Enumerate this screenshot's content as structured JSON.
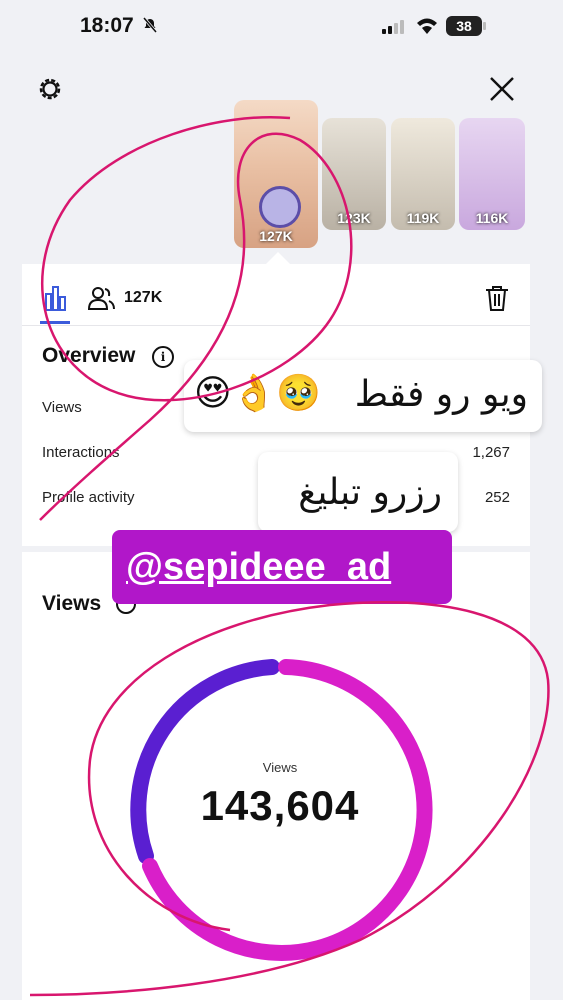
{
  "status_bar": {
    "time": "18:07",
    "battery": "38"
  },
  "stories": [
    {
      "label": "127K"
    },
    {
      "label": "123K"
    },
    {
      "label": "119K"
    },
    {
      "label": "116K"
    }
  ],
  "tabs": {
    "audience_count": "127K"
  },
  "overview": {
    "title": "Overview",
    "rows": [
      {
        "label": "Views",
        "value": ""
      },
      {
        "label": "Interactions",
        "value": "1,267"
      },
      {
        "label": "Profile activity",
        "value": "252"
      }
    ]
  },
  "views_section": {
    "title": "Views",
    "donut_label": "Views",
    "donut_value": "143,604"
  },
  "stickers": {
    "line1": "ویو رو فقط",
    "line1_emojis": "😍👌🥹",
    "line2": "رزرو تبلیغ",
    "mention": "@sepideee_ad"
  },
  "colors": {
    "donut_purple": "#5a1fd1",
    "donut_pink": "#d91fc9",
    "scribble": "#d8166e",
    "mention_bg": "#b117c9"
  }
}
